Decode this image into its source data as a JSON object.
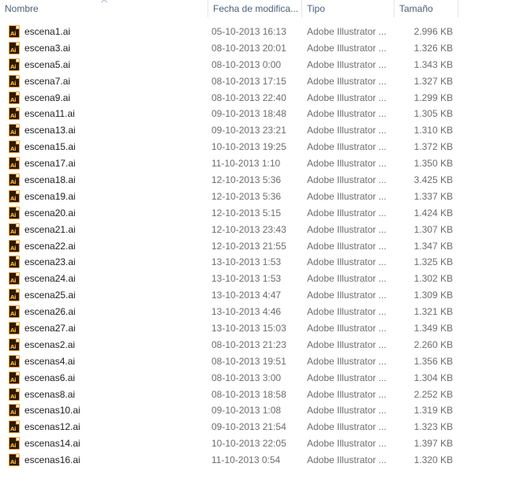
{
  "columns": {
    "name": "Nombre",
    "date": "Fecha de modifica...",
    "type": "Tipo",
    "size": "Tamaño"
  },
  "icon": "adobe-illustrator-file-icon",
  "icon_text": "Ai",
  "colors": {
    "header_text": "#4c607a",
    "icon_bg": "#2b1a00",
    "icon_accent": "#f3a13a"
  },
  "files": [
    {
      "name": "escena1.ai",
      "date": "05-10-2013 16:13",
      "type": "Adobe Illustrator ...",
      "size": "2.996 KB"
    },
    {
      "name": "escena3.ai",
      "date": "08-10-2013 20:01",
      "type": "Adobe Illustrator ...",
      "size": "1.326 KB"
    },
    {
      "name": "escena5.ai",
      "date": "08-10-2013 0:00",
      "type": "Adobe Illustrator ...",
      "size": "1.343 KB"
    },
    {
      "name": "escena7.ai",
      "date": "08-10-2013 17:15",
      "type": "Adobe Illustrator ...",
      "size": "1.327 KB"
    },
    {
      "name": "escena9.ai",
      "date": "08-10-2013 22:40",
      "type": "Adobe Illustrator ...",
      "size": "1.299 KB"
    },
    {
      "name": "escena11.ai",
      "date": "09-10-2013 18:48",
      "type": "Adobe Illustrator ...",
      "size": "1.305 KB"
    },
    {
      "name": "escena13.ai",
      "date": "09-10-2013 23:21",
      "type": "Adobe Illustrator ...",
      "size": "1.310 KB"
    },
    {
      "name": "escena15.ai",
      "date": "10-10-2013 19:25",
      "type": "Adobe Illustrator ...",
      "size": "1.372 KB"
    },
    {
      "name": "escena17.ai",
      "date": "11-10-2013 1:10",
      "type": "Adobe Illustrator ...",
      "size": "1.350 KB"
    },
    {
      "name": "escena18.ai",
      "date": "12-10-2013 5:36",
      "type": "Adobe Illustrator ...",
      "size": "3.425 KB"
    },
    {
      "name": "escena19.ai",
      "date": "12-10-2013 5:36",
      "type": "Adobe Illustrator ...",
      "size": "1.337 KB"
    },
    {
      "name": "escena20.ai",
      "date": "12-10-2013 5:15",
      "type": "Adobe Illustrator ...",
      "size": "1.424 KB"
    },
    {
      "name": "escena21.ai",
      "date": "12-10-2013 23:43",
      "type": "Adobe Illustrator ...",
      "size": "1.307 KB"
    },
    {
      "name": "escena22.ai",
      "date": "12-10-2013 21:55",
      "type": "Adobe Illustrator ...",
      "size": "1.347 KB"
    },
    {
      "name": "escena23.ai",
      "date": "13-10-2013 1:53",
      "type": "Adobe Illustrator ...",
      "size": "1.325 KB"
    },
    {
      "name": "escena24.ai",
      "date": "13-10-2013 1:53",
      "type": "Adobe Illustrator ...",
      "size": "1.302 KB"
    },
    {
      "name": "escena25.ai",
      "date": "13-10-2013 4:47",
      "type": "Adobe Illustrator ...",
      "size": "1.309 KB"
    },
    {
      "name": "escena26.ai",
      "date": "13-10-2013 4:46",
      "type": "Adobe Illustrator ...",
      "size": "1.321 KB"
    },
    {
      "name": "escena27.ai",
      "date": "13-10-2013 15:03",
      "type": "Adobe Illustrator ...",
      "size": "1.349 KB"
    },
    {
      "name": "escenas2.ai",
      "date": "08-10-2013 21:23",
      "type": "Adobe Illustrator ...",
      "size": "2.260 KB"
    },
    {
      "name": "escenas4.ai",
      "date": "08-10-2013 19:51",
      "type": "Adobe Illustrator ...",
      "size": "1.356 KB"
    },
    {
      "name": "escenas6.ai",
      "date": "08-10-2013 3:00",
      "type": "Adobe Illustrator ...",
      "size": "1.304 KB"
    },
    {
      "name": "escenas8.ai",
      "date": "08-10-2013 18:58",
      "type": "Adobe Illustrator ...",
      "size": "2.252 KB"
    },
    {
      "name": "escenas10.ai",
      "date": "09-10-2013 1:08",
      "type": "Adobe Illustrator ...",
      "size": "1.319 KB"
    },
    {
      "name": "escenas12.ai",
      "date": "09-10-2013 21:54",
      "type": "Adobe Illustrator ...",
      "size": "1.323 KB"
    },
    {
      "name": "escenas14.ai",
      "date": "10-10-2013 22:05",
      "type": "Adobe Illustrator ...",
      "size": "1.397 KB"
    },
    {
      "name": "escenas16.ai",
      "date": "11-10-2013 0:54",
      "type": "Adobe Illustrator ...",
      "size": "1.320 KB"
    }
  ]
}
